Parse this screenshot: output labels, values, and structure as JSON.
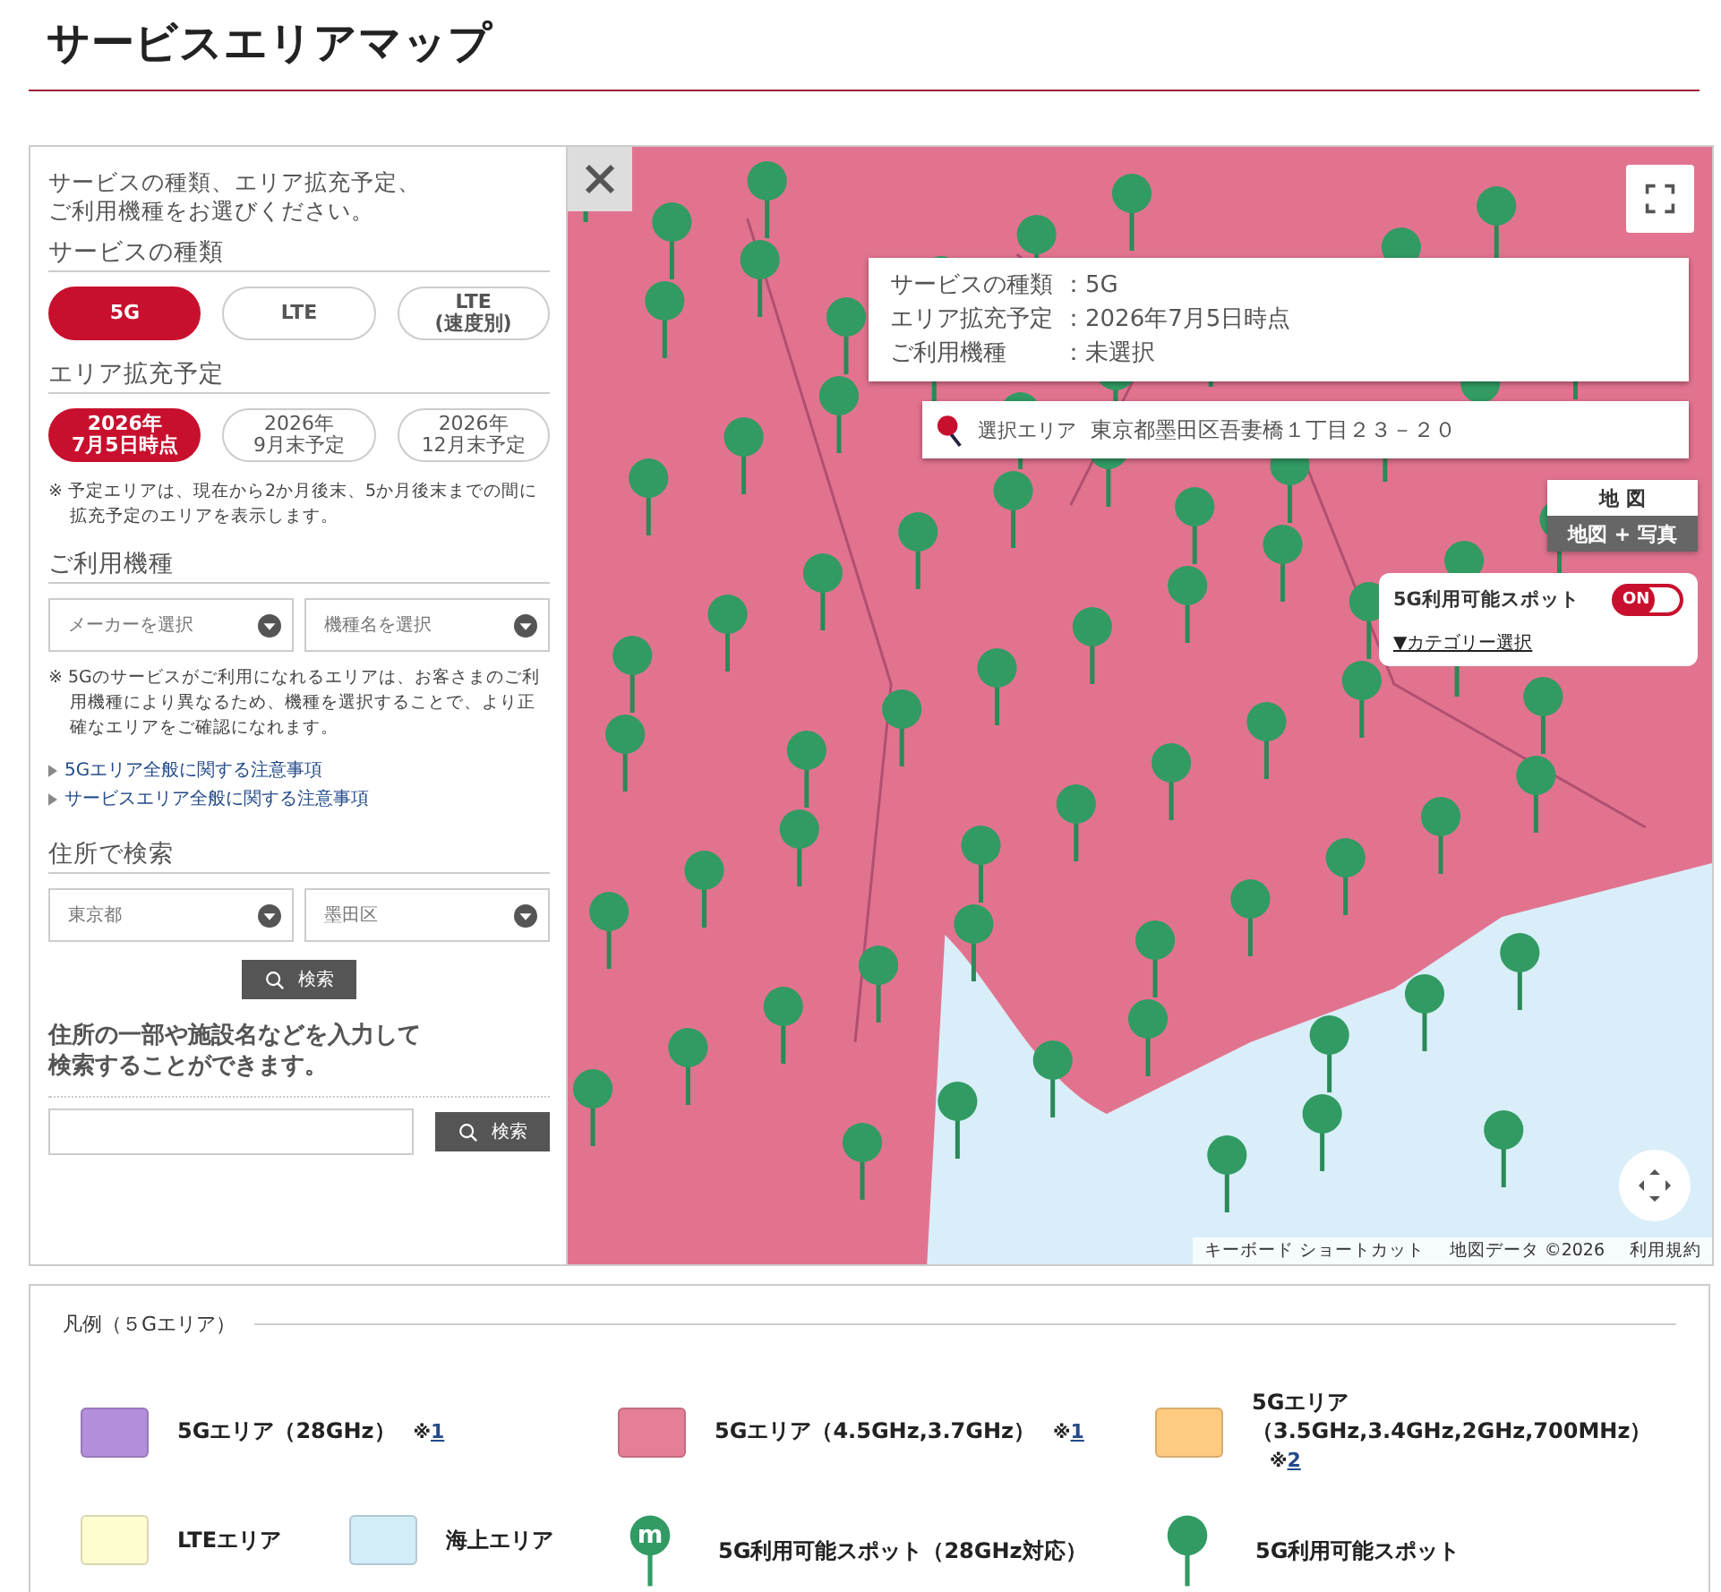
{
  "page_title": "サービスエリアマップ",
  "sidebar": {
    "intro": [
      "サービスの種類、エリア拡充予定、",
      "ご利用機種をお選びください。"
    ],
    "service_type": {
      "heading": "サービスの種類",
      "options": [
        {
          "label": "5G",
          "selected": true
        },
        {
          "label": "LTE",
          "selected": false
        },
        {
          "label": "LTE\n(速度別)",
          "selected": false
        }
      ]
    },
    "expansion": {
      "heading": "エリア拡充予定",
      "options": [
        {
          "label": "2026年\n7月5日時点",
          "selected": true
        },
        {
          "label": "2026年\n9月末予定",
          "selected": false
        },
        {
          "label": "2026年\n12月末予定",
          "selected": false
        }
      ],
      "note": "※ 予定エリアは、現在から2か月後末、5か月後末までの間に拡充予定のエリアを表示します。"
    },
    "device": {
      "heading": "ご利用機種",
      "selects": [
        {
          "placeholder": "メーカーを選択"
        },
        {
          "placeholder": "機種名を選択"
        }
      ],
      "note": "※ 5Gのサービスがご利用になれるエリアは、お客さまのご利用機種により異なるため、機種を選択することで、より正確なエリアをご確認になれます。"
    },
    "links": [
      "5Gエリア全般に関する注意事項",
      "サービスエリア全般に関する注意事項"
    ],
    "address": {
      "heading": "住所で検索",
      "selects": [
        {
          "value": "東京都"
        },
        {
          "value": "墨田区"
        }
      ],
      "button": "検索"
    },
    "freetext": {
      "description": [
        "住所の一部や施設名などを入力して",
        "検索することができます。"
      ],
      "button": "検索"
    }
  },
  "map": {
    "info": [
      {
        "label": "サービスの種類",
        "separator": "：",
        "value": "5G"
      },
      {
        "label": "エリア拡充予定",
        "separator": "：",
        "value": "2026年7月5日時点"
      },
      {
        "label": "ご利用機種",
        "separator": "：",
        "value": "未選択"
      }
    ],
    "selected_area": {
      "label": "選択エリア",
      "value": "東京都墨田区吾妻橋１丁目２３－２０"
    },
    "map_types": [
      {
        "label": "地 図",
        "selected": false
      },
      {
        "label": "地図 + 写真",
        "selected": true
      }
    ],
    "spot_toggle": {
      "label": "5G利用可能スポット",
      "on": true,
      "state_text": "ON",
      "category_link": "▼カテゴリー選択"
    },
    "footer": [
      "キーボード ショートカット",
      "地図データ ©2026",
      "利用規約"
    ]
  },
  "legend": {
    "title": "凡例（５Gエリア）",
    "items": [
      {
        "kind": "swatch",
        "color": "#b38edb",
        "label": [
          "5Gエリア（28GHz）"
        ],
        "note_mark": "※",
        "note_link": "1"
      },
      {
        "kind": "swatch",
        "color": "#e57f96",
        "label": [
          "5Gエリア（4.5GHz,3.7GHz）"
        ],
        "note_mark": "※",
        "note_link": "1"
      },
      {
        "kind": "swatch",
        "color": "#fecb80",
        "label": [
          "5Gエリア",
          "（3.5GHz,3.4GHz,2GHz,700MHz）"
        ],
        "note_mark": "※",
        "note_link": "2"
      },
      {
        "kind": "swatch",
        "color": "#fefdd0",
        "label": "LTEエリア"
      },
      {
        "kind": "swatch",
        "color": "#d2ecf8",
        "label": "海上エリア"
      },
      {
        "kind": "pin",
        "color": "#319b63",
        "pin_letter": "m",
        "label": "5G利用可能スポット（28GHz対応）"
      },
      {
        "kind": "pin",
        "color": "#319b63",
        "label": "5G利用可能スポット"
      }
    ]
  }
}
